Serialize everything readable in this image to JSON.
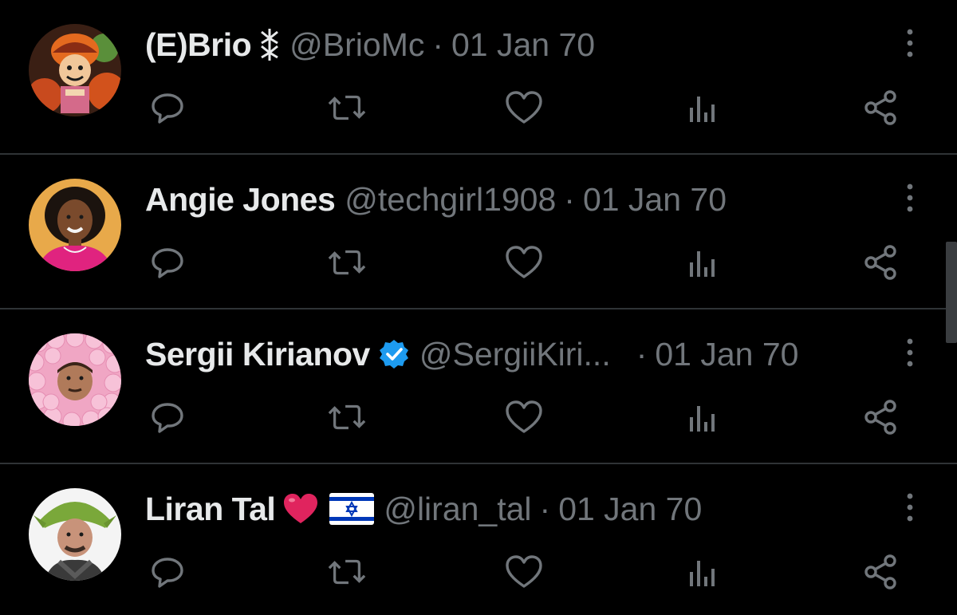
{
  "colors": {
    "background": "#000000",
    "name_text": "#e7e9ea",
    "secondary_text": "#71767b",
    "divider": "#2f3336",
    "verified_badge": "#1d9bf0",
    "heart_emoji": "#e0245e"
  },
  "tweets": [
    {
      "name": "(E)Brio",
      "name_extra_icon": "berserk-brand-icon",
      "handle": "@BrioMc",
      "separator": "·",
      "date": "01 Jan 70",
      "avatar": "anime-character-avatar"
    },
    {
      "name": "Angie Jones",
      "handle": "@techgirl1908",
      "separator": "·",
      "date": "01 Jan 70",
      "avatar": "woman-portrait-avatar"
    },
    {
      "name": "Sergii Kirianov",
      "name_extra_icon": "verified-badge-icon",
      "handle": "@SergiiKiri...",
      "separator": "·",
      "date": "01 Jan 70",
      "avatar": "face-in-pink-balls-avatar"
    },
    {
      "name": "Liran Tal",
      "name_extra_icon": "red-heart-emoji and israel-flag-emoji",
      "handle": "@liran_tal",
      "separator": "·",
      "date": "01 Jan 70",
      "avatar": "man-green-hat-avatar"
    }
  ],
  "action_icons": [
    "reply-icon",
    "retweet-icon",
    "like-icon",
    "views-icon",
    "share-icon"
  ],
  "more_icon": "more-vertical-icon"
}
